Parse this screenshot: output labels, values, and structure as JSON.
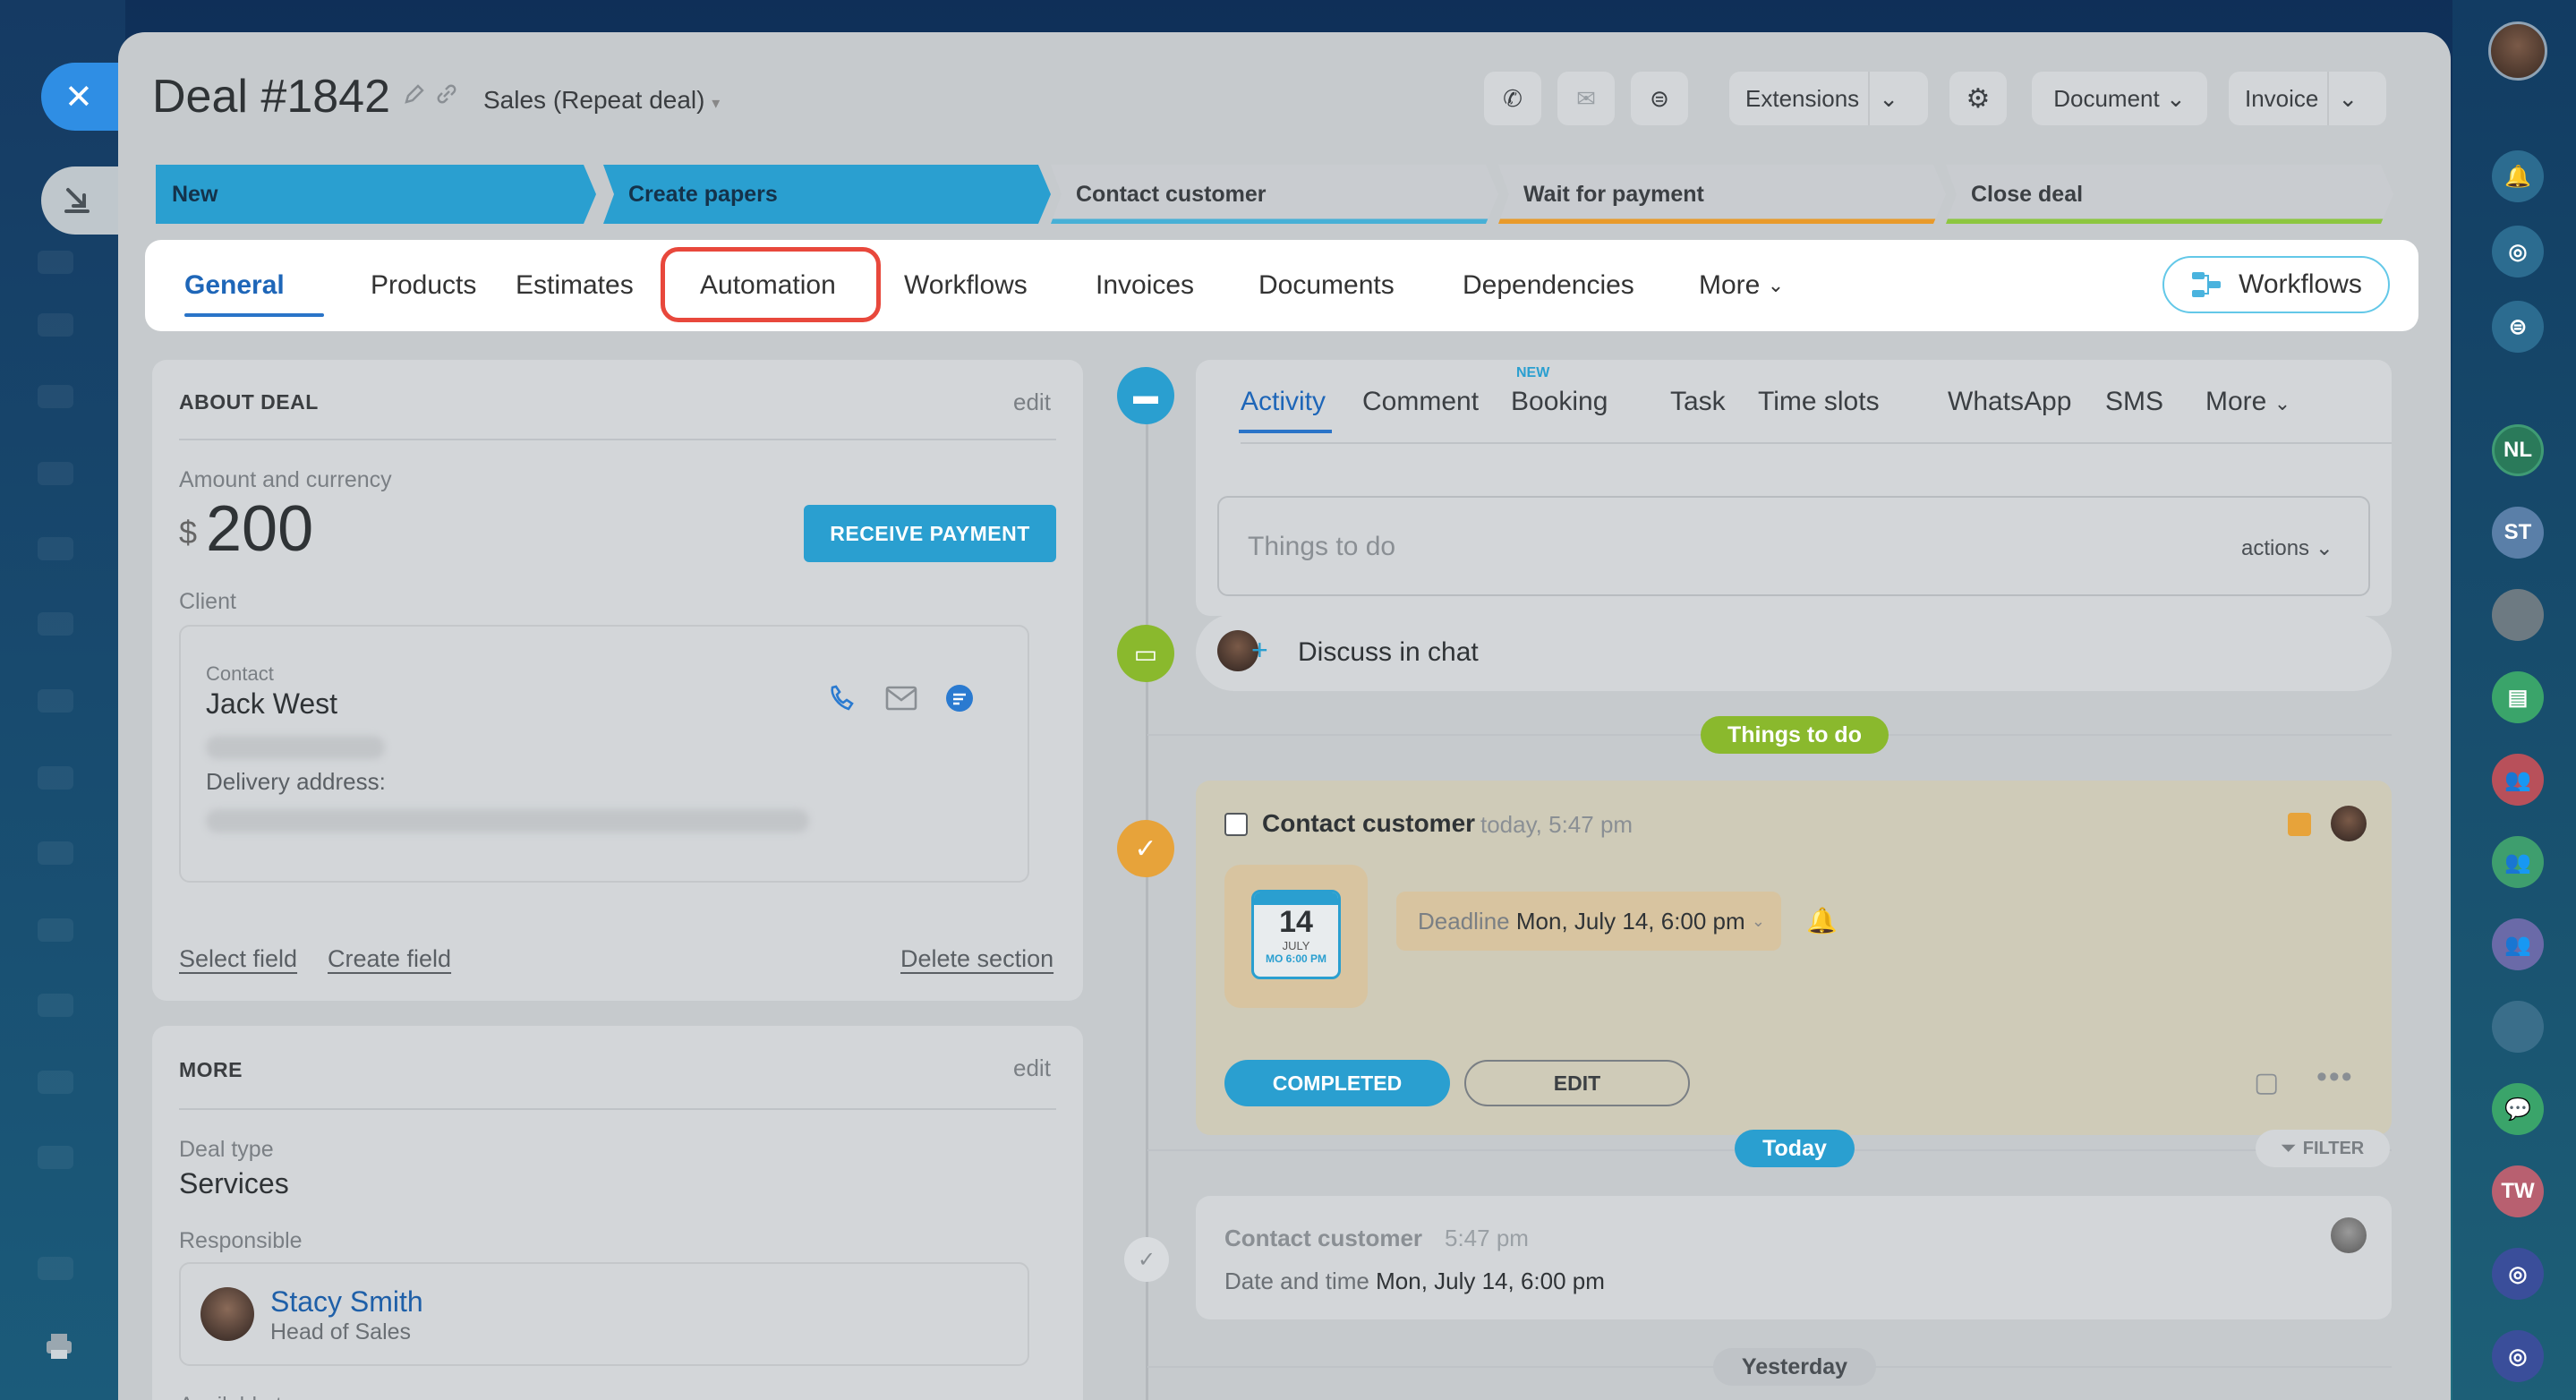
{
  "deal": {
    "title": "Deal #1842",
    "category": "Sales (Repeat deal)"
  },
  "toolbar": {
    "extensions_label": "Extensions",
    "document_label": "Document",
    "invoice_label": "Invoice"
  },
  "stages": [
    {
      "label": "New",
      "color": "#2a9fd0"
    },
    {
      "label": "Create papers",
      "color": "#2a9fd0"
    },
    {
      "label": "Contact customer",
      "color": "#c9ccd0",
      "underline": "#47b0d6"
    },
    {
      "label": "Wait for payment",
      "color": "#c9ccd0",
      "underline": "#e89a2a"
    },
    {
      "label": "Close deal",
      "color": "#c9ccd0",
      "underline": "#8cc63f"
    }
  ],
  "tabs": {
    "general": "General",
    "products": "Products",
    "estimates": "Estimates",
    "automation": "Automation",
    "workflows": "Workflows",
    "invoices": "Invoices",
    "documents": "Documents",
    "dependencies": "Dependencies",
    "more": "More",
    "workflows_button": "Workflows"
  },
  "about": {
    "heading": "ABOUT DEAL",
    "edit": "edit",
    "amount_label": "Amount and currency",
    "currency_symbol": "$",
    "amount": "200",
    "receive_payment": "RECEIVE PAYMENT",
    "client_label": "Client",
    "contact_label": "Contact",
    "contact_name": "Jack West",
    "delivery_label": "Delivery address:",
    "select_field": "Select field",
    "create_field": "Create field",
    "delete_section": "Delete section"
  },
  "more_section": {
    "heading": "MORE",
    "edit": "edit",
    "deal_type_label": "Deal type",
    "deal_type": "Services",
    "responsible_label": "Responsible",
    "responsible_name": "Stacy Smith",
    "responsible_role": "Head of Sales",
    "available_label": "Available to everyone"
  },
  "activity": {
    "tabs": {
      "activity": "Activity",
      "comment": "Comment",
      "booking": "Booking",
      "booking_badge": "NEW",
      "task": "Task",
      "time_slots": "Time slots",
      "whatsapp": "WhatsApp",
      "sms": "SMS",
      "more": "More"
    },
    "input_placeholder": "Things to do",
    "actions_label": "actions"
  },
  "timeline": {
    "discuss": "Discuss in chat",
    "things_to_do_pill": "Things to do",
    "task": {
      "title": "Contact customer",
      "time": "today, 5:47 pm",
      "cal_day": "14",
      "cal_month": "JULY",
      "cal_time": "MO 6:00 PM",
      "deadline_label": "Deadline",
      "deadline_value": "Mon, July 14, 6:00 pm",
      "completed_btn": "COMPLETED",
      "edit_btn": "EDIT"
    },
    "today_pill": "Today",
    "filter_label": "FILTER",
    "history": {
      "title": "Contact customer",
      "time": "5:47 pm",
      "detail_label": "Date and time",
      "detail_value": "Mon, July 14, 6:00 pm"
    },
    "yesterday_pill": "Yesterday"
  },
  "right_bar": {
    "initials_1": "NL",
    "initials_2": "ST",
    "initials_3": "TW"
  },
  "colors": {
    "accent_blue": "#2a9fd0",
    "link_blue": "#1e66b8",
    "highlight_red": "#e8483c",
    "green": "#8ab92d",
    "orange": "#e7a33a"
  }
}
